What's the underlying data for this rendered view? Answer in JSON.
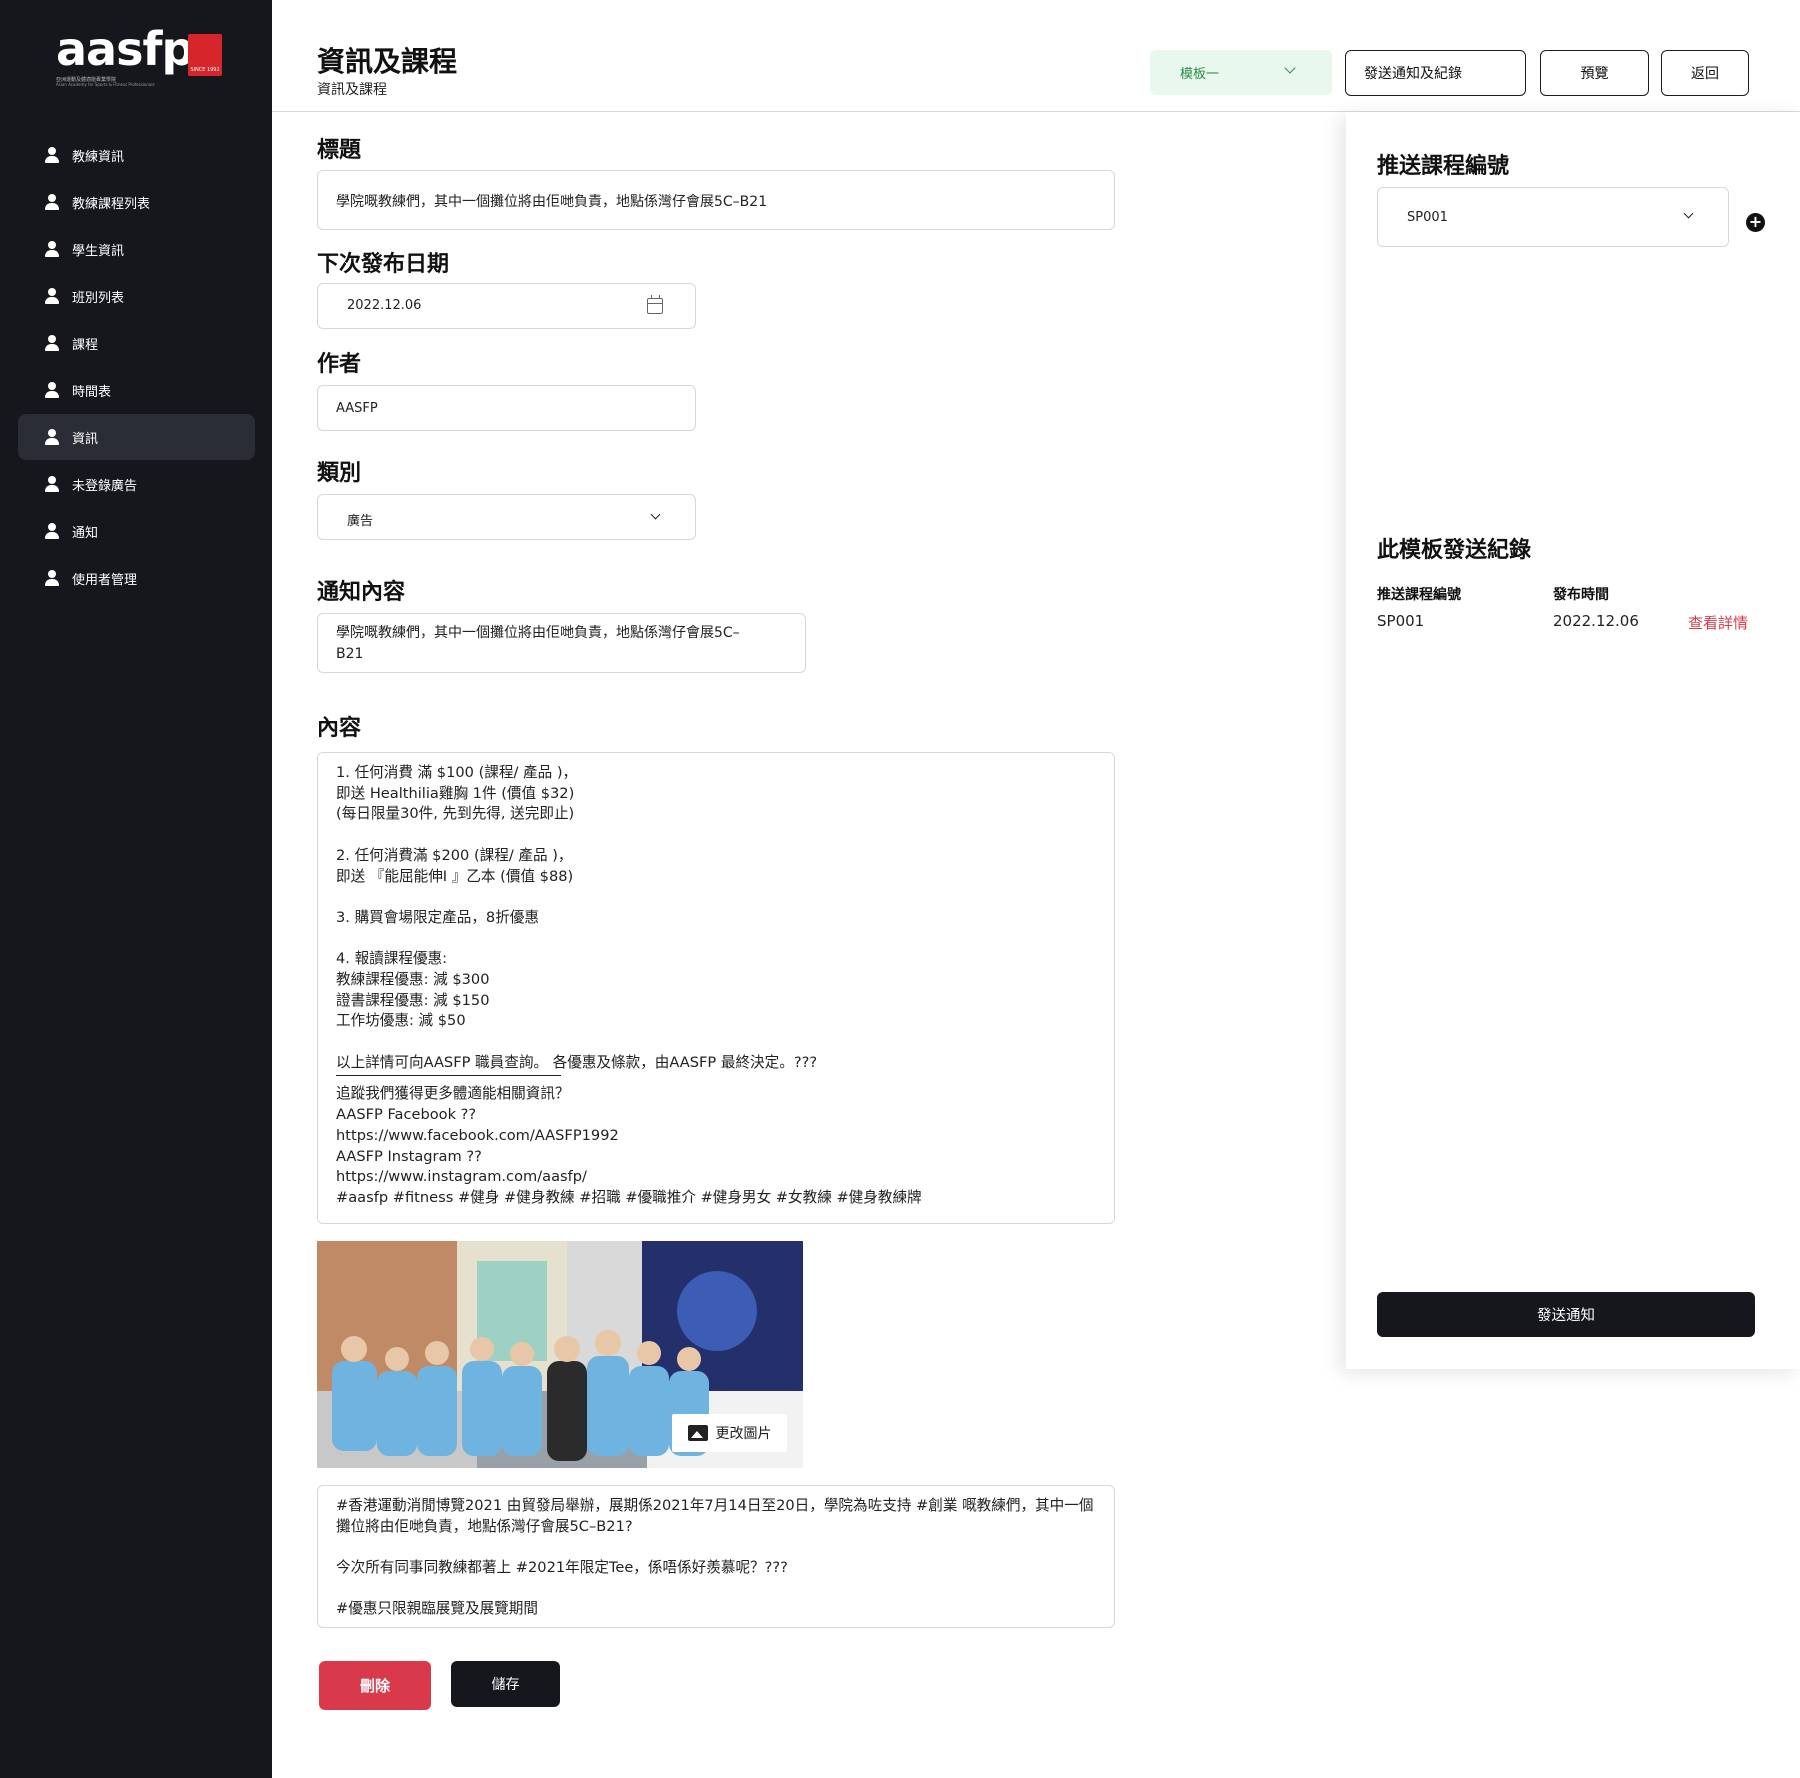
{
  "sidebar": {
    "logo": {
      "wordmark": "aasfp",
      "since": "SINCE 1992",
      "subtitle_cn": "亞洲運動及體適能專業學院",
      "subtitle_en": "Asian Academy for Sports & Fitness Professionals"
    },
    "items": [
      {
        "label": "教練資訊",
        "icon": "user-icon"
      },
      {
        "label": "教練課程列表",
        "icon": "user-icon"
      },
      {
        "label": "學生資訊",
        "icon": "user-icon"
      },
      {
        "label": "班別列表",
        "icon": "user-icon"
      },
      {
        "label": "課程",
        "icon": "user-icon"
      },
      {
        "label": "時間表",
        "icon": "user-icon"
      },
      {
        "label": "資訊",
        "icon": "user-icon",
        "active": true
      },
      {
        "label": "未登錄廣告",
        "icon": "user-icon"
      },
      {
        "label": "通知",
        "icon": "user-icon"
      },
      {
        "label": "使用者管理",
        "icon": "user-icon"
      }
    ]
  },
  "header": {
    "title": "資訊及課程",
    "subtitle": "資訊及課程",
    "template_select": "模板一",
    "send_log_button": "發送通知及紀錄",
    "preview_button": "預覽",
    "back_button": "返回"
  },
  "form": {
    "title_label": "標題",
    "title_value": "學院嘅教練們，其中一個攤位將由佢哋負責，地點係灣仔會展5C–B21",
    "next_date_label": "下次發布日期",
    "next_date_value": "2022.12.06",
    "author_label": "作者",
    "author_value": "AASFP",
    "category_label": "類別",
    "category_value": "廣告",
    "notify_label": "通知內容",
    "notify_line1": "學院嘅教練們，其中一個攤位將由佢哋負責，地點係灣仔會展5C–",
    "notify_line2": "B21",
    "content_label": "內容",
    "content_lines": {
      "l1": "1. 任何消費 滿 $100 (課程/ 產品 )，",
      "l2": "即送 Healthilia雞胸 1件 (價值 $32)",
      "l3": "(每日限量30件, 先到先得, 送完即止)",
      "l4": "2. 任何消費滿 $200 (課程/ 產品 )，",
      "l5": "即送 『能屈能伸I 』乙本 (價值 $88)",
      "l6": "3. 購買會場限定產品，8折優惠",
      "l7": "4. 報讀課程優惠:",
      "l8": "教練課程優惠: 減 $300",
      "l9": "證書課程優惠: 減 $150",
      "l10": "工作坊優惠: 減 $50",
      "l11": "以上詳情可向AASFP 職員查詢。 各優惠及條款，由AASFP 最終決定。???",
      "l12": "追蹤我們獲得更多體適能相關資訊？",
      "l13": "AASFP Facebook ??",
      "l14": "https://www.facebook.com/AASFP1992",
      "l15": "AASFP Instagram ??",
      "l16": "https://www.instagram.com/aasfp/",
      "l17": "#aasfp #fitness #健身 #健身教練 #招職 #優職推介 #健身男女 #女教練 #健身教練牌"
    },
    "change_image_button": "更改圖片",
    "caption_lines": {
      "c1": "#香港運動消閒博覽2021 由貿發局舉辦，展期係2021年7月14日至20日，學院為咗支持 #創業 嘅教練們，其中一個",
      "c2": "攤位將由佢哋負責，地點係灣仔會展5C–B21?",
      "c3": "今次所有同事同教練都著上 #2021年限定Tee，係唔係好羨慕呢？???",
      "c4": "#優惠只限親臨展覽及展覽期間"
    },
    "delete_button": "刪除",
    "save_button": "儲存"
  },
  "right_panel": {
    "push_title": "推送課程編號",
    "course_select_value": "SP001",
    "log_title": "此模板發送紀錄",
    "col_course": "推送課程編號",
    "col_time": "發布時間",
    "row_course": "SP001",
    "row_time": "2022.12.06",
    "view_details": "查看詳情",
    "send_button": "發送通知"
  },
  "colors": {
    "sidebar_bg": "#15171c",
    "accent_red": "#d83a4b",
    "template_green_bg": "#e8f8ec",
    "template_green_text": "#2c8a4b"
  }
}
